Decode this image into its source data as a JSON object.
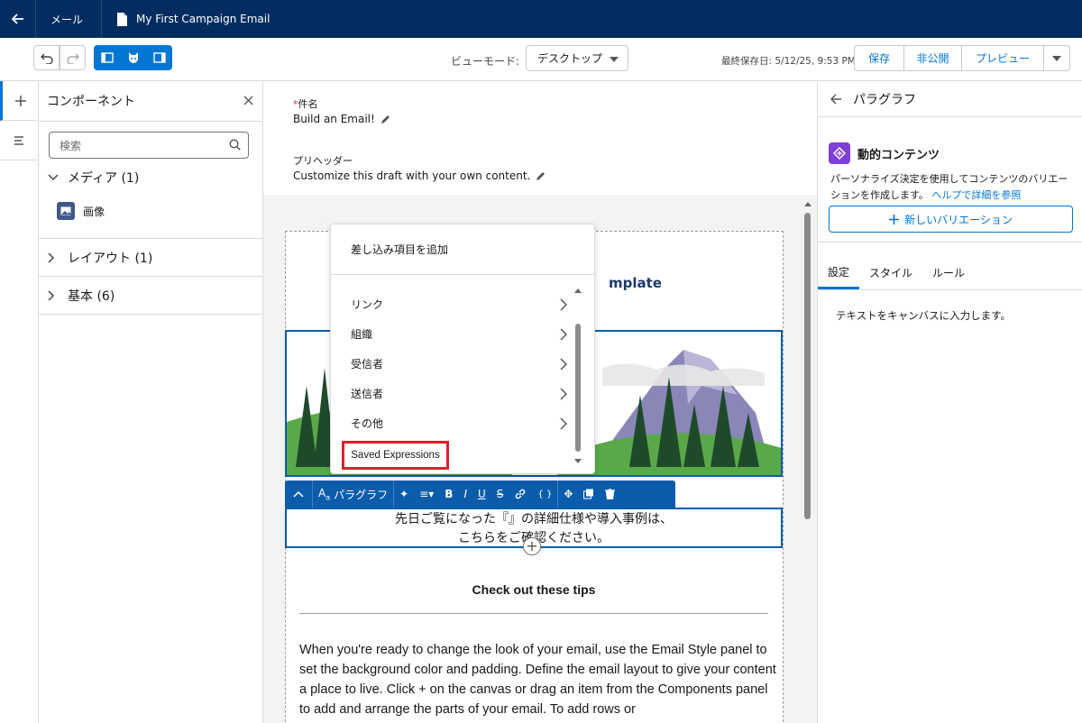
{
  "topbar": {
    "tab_label": "メール",
    "doc_title": "My First Campaign Email"
  },
  "toolbar": {
    "view_mode_label": "ビューモード:",
    "view_mode_value": "デスクトップ",
    "last_saved": "最終保存日: 5/12/25, 9:53 PM",
    "save_label": "保存",
    "unpublish_label": "非公開",
    "preview_label": "プレビュー"
  },
  "components": {
    "title": "コンポーネント",
    "search_placeholder": "検索",
    "groups": [
      {
        "label": "メディア (1)",
        "expanded": true,
        "items": [
          {
            "label": "画像",
            "icon": "image-icon"
          }
        ]
      },
      {
        "label": "レイアウト (1)",
        "expanded": false
      },
      {
        "label": "基本 (6)",
        "expanded": false
      }
    ]
  },
  "email": {
    "subject_label": "件名",
    "subject_value": "Build an Email!",
    "preheader_label": "プリヘッダー",
    "preheader_value": "Customize this draft with your own content.",
    "template_title_fragment": "mplate",
    "text_line1": "先日ご覧になった『』の詳細仕様や導入事例は、",
    "text_line2": "こちらをご確認ください。",
    "tips_title": "Check out these tips",
    "tips_body": "When you're ready to change the look of your email, use the Email Style panel to set the background color and padding. Define the email layout to give your content a place to live. Click + on the canvas or drag an item from the Components panel to add and arrange the parts of your email. To add rows or"
  },
  "text_toolbar": {
    "style_label": "パラグラフ",
    "bold": "B",
    "italic": "I",
    "underline": "U",
    "merge": "{ }"
  },
  "merge_dropdown": {
    "header": "差し込み項目を追加",
    "items": [
      "リンク",
      "組織",
      "受信者",
      "送信者",
      "その他"
    ],
    "saved_expressions": "Saved Expressions"
  },
  "right_panel": {
    "title": "パラグラフ",
    "dynamic_title": "動的コンテンツ",
    "dynamic_desc": "パーソナライズ決定を使用してコンテンツのバリエーションを作成します。",
    "help_link": "ヘルプで詳細を参照",
    "new_variation": "新しいバリエーション",
    "tabs": [
      "設定",
      "スタイル",
      "ルール"
    ],
    "hint": "テキストをキャンバスに入力します。"
  },
  "colors": {
    "topbar": "#032d60",
    "brand_blue": "#0176d3",
    "selection_blue": "#0b5cab",
    "highlight_red": "#e0202a",
    "dynamic_purple": "#7f3ed6"
  }
}
